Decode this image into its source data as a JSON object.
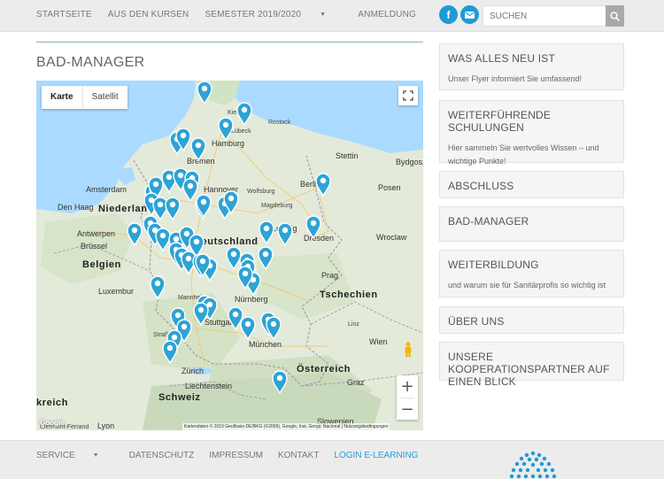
{
  "nav": {
    "items": [
      "STARTSEITE",
      "AUS DEN KURSEN",
      "SEMESTER 2019/2020",
      "ANMELDUNG"
    ],
    "facebook_glyph": "f",
    "search_placeholder": "SUCHEN"
  },
  "page": {
    "title": "BAD-MANAGER"
  },
  "map": {
    "type_map": "Karte",
    "type_satellite": "Satellit",
    "attribution": "Kartendaten © 2019 GeoBasis-DE/BKG (©2009), Google, Inst. Geogr. Nacional | Nutzungsbedingungen",
    "google": "Google",
    "labels": {
      "deutschland": "Deutschland",
      "niederlande": "Niederlan",
      "belgien": "Belgien",
      "tschechien": "Tschechien",
      "oesterreich": "Österreich",
      "schweiz": "Schweiz",
      "frankreich": "kreich",
      "liechtenstein": "Liechtenstein",
      "luxemburg": "Luxembur",
      "slowenien": "Slowenien",
      "kiel": "Kiel",
      "luebeck": "Lübeck",
      "rostock": "Rostock",
      "hamburg": "Hamburg",
      "bremen": "Bremen",
      "stettin": "Stettin",
      "bydgoszcz": "Bydgoszc",
      "amsterdam": "Amsterdam",
      "den_haag": "Den Haag",
      "hannover": "Hannover",
      "wolfsburg": "Wolfsburg",
      "berlin": "Berlin",
      "posen": "Posen",
      "magdeburg": "Magdeburg",
      "antwerpen": "Antwerpen",
      "leipzig": "Leipzig",
      "dresden": "Dresden",
      "wroclaw": "Wroclaw",
      "bruessel": "Brüssel",
      "prag": "Prag",
      "mannheim": "Mannheim",
      "nuernberg": "Nürnberg",
      "strassburg": "Straßburg",
      "stuttgart": "Stuttgart",
      "muenchen": "München",
      "wien": "Wien",
      "zuerich": "Zürich",
      "graz": "Graz",
      "lyon": "Lyon",
      "ferrand": "Clermont-Ferrand",
      "linz": "Linz"
    }
  },
  "sidebar": [
    {
      "title": "WAS ALLES NEU IST",
      "text": "Unser Flyer informiert Sie umfassend!"
    },
    {
      "title": "WEITERFÜHRENDE SCHULUNGEN",
      "text": "Hier sammeln Sie wertvolles Wissen – und wichtige Punkte!"
    },
    {
      "title": "ABSCHLUSS",
      "text": ""
    },
    {
      "title": "BAD-MANAGER",
      "text": ""
    },
    {
      "title": "WEITERBILDUNG",
      "text": "und warum sie für Sanitärprofis so wichtig ist"
    },
    {
      "title": "ÜBER UNS",
      "text": ""
    },
    {
      "title": "UNSERE KOOPERATIONSPARTNER AUF EINEN BLICK",
      "text": ""
    }
  ],
  "footer": {
    "items": [
      "SERVICE",
      "DATENSCHUTZ",
      "IMPRESSUM",
      "KONTAKT",
      "LOGIN E-LEARNING"
    ]
  },
  "colors": {
    "accent": "#1e9ad6",
    "pin": "#2ea3d5",
    "link": "#2a9bd4"
  }
}
